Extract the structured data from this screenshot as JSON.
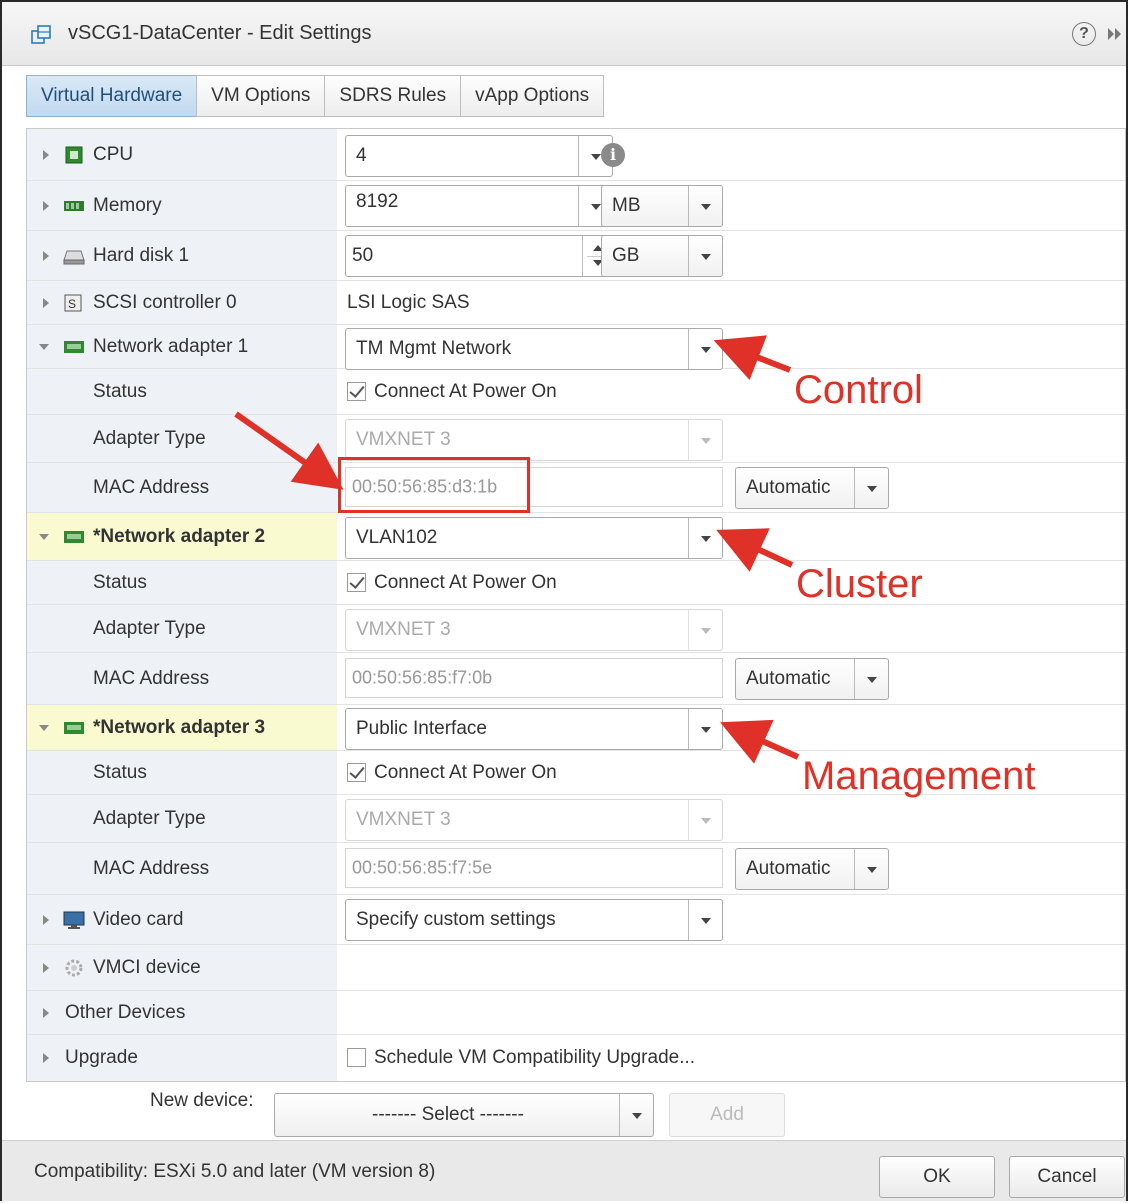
{
  "window": {
    "title": "vSCG1-DataCenter - Edit Settings"
  },
  "tabs": [
    {
      "label": "Virtual Hardware",
      "active": true
    },
    {
      "label": "VM Options",
      "active": false
    },
    {
      "label": "SDRS Rules",
      "active": false
    },
    {
      "label": "vApp Options",
      "active": false
    }
  ],
  "hardware": {
    "cpu": {
      "label": "CPU",
      "value": "4"
    },
    "memory": {
      "label": "Memory",
      "value": "8192",
      "unit": "MB"
    },
    "hard_disk": {
      "label": "Hard disk 1",
      "value": "50",
      "unit": "GB"
    },
    "scsi": {
      "label": "SCSI controller 0",
      "value": "LSI Logic SAS"
    },
    "adapters": [
      {
        "label": "Network adapter 1",
        "network": "TM Mgmt Network",
        "status_label": "Status",
        "status_value": "Connect At Power On",
        "type_label": "Adapter Type",
        "type_value": "VMXNET 3",
        "mac_label": "MAC Address",
        "mac_value": "00:50:56:85:d3:1b",
        "mac_mode": "Automatic"
      },
      {
        "label": "*Network adapter 2",
        "network": "VLAN102",
        "status_label": "Status",
        "status_value": "Connect At Power On",
        "type_label": "Adapter Type",
        "type_value": "VMXNET 3",
        "mac_label": "MAC Address",
        "mac_value": "00:50:56:85:f7:0b",
        "mac_mode": "Automatic"
      },
      {
        "label": "*Network adapter 3",
        "network": "Public Interface",
        "status_label": "Status",
        "status_value": "Connect At Power On",
        "type_label": "Adapter Type",
        "type_value": "VMXNET 3",
        "mac_label": "MAC Address",
        "mac_value": "00:50:56:85:f7:5e",
        "mac_mode": "Automatic"
      }
    ],
    "video": {
      "label": "Video card",
      "value": "Specify custom settings"
    },
    "vmci": {
      "label": "VMCI device"
    },
    "other": {
      "label": "Other Devices"
    },
    "upgrade": {
      "label": "Upgrade",
      "value": "Schedule VM Compatibility Upgrade..."
    }
  },
  "annotations": {
    "control": "Control",
    "cluster": "Cluster",
    "management": "Management",
    "color": "#e03128"
  },
  "new_device": {
    "label": "New device:",
    "select": "------- Select -------",
    "add": "Add"
  },
  "footer": {
    "compatibility": "Compatibility: ESXi 5.0 and later (VM version 8)",
    "ok": "OK",
    "cancel": "Cancel"
  },
  "icons": [
    "vm-icon",
    "help-icon",
    "expand-icon",
    "cpu-icon",
    "memory-icon",
    "hard-disk-icon",
    "scsi-icon",
    "network-adapter-icon",
    "video-card-icon",
    "vmci-icon",
    "info-icon"
  ]
}
